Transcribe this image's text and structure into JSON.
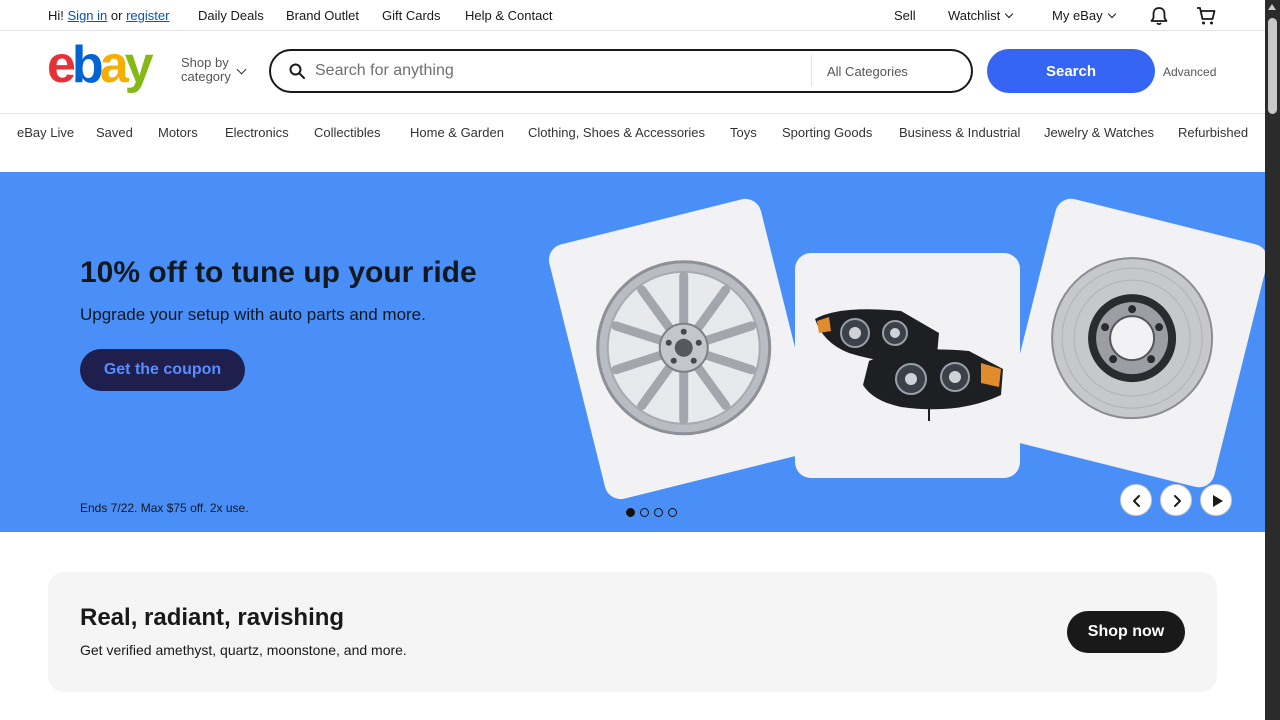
{
  "topbar": {
    "greeting": "Hi!",
    "sign_in": "Sign in",
    "or": "or",
    "register": "register",
    "links": [
      "Daily Deals",
      "Brand Outlet",
      "Gift Cards",
      "Help & Contact"
    ],
    "sell": "Sell",
    "watchlist": "Watchlist",
    "my_ebay": "My eBay",
    "icons": [
      "bell-icon",
      "cart-icon"
    ]
  },
  "header": {
    "logo_text": "ebay",
    "shop_by_line1": "Shop by",
    "shop_by_line2": "category",
    "search_placeholder": "Search for anything",
    "category_value": "All Categories",
    "search_button": "Search",
    "advanced": "Advanced"
  },
  "nav": {
    "items": [
      "eBay Live",
      "Saved",
      "Motors",
      "Electronics",
      "Collectibles",
      "Home & Garden",
      "Clothing, Shoes & Accessories",
      "Toys",
      "Sporting Goods",
      "Business & Industrial",
      "Jewelry & Watches",
      "Refurbished"
    ]
  },
  "hero": {
    "title": "10% off to tune up your ride",
    "subtitle": "Upgrade your setup with auto parts and more.",
    "cta": "Get the coupon",
    "terms": "Ends 7/22. Max $75 off. 2x use.",
    "slides_total": 4,
    "active_slide": 1,
    "images": [
      "wheel-rim-image",
      "headlights-image",
      "brake-rotor-image"
    ],
    "bg_color": "#4a8ff7"
  },
  "promo": {
    "title": "Real, radiant, ravishing",
    "text": "Get verified amethyst, quartz, moonstone, and more.",
    "cta": "Shop now"
  },
  "colors": {
    "accent": "#3665f3",
    "link": "#0654ba",
    "logo_e": "#e53238",
    "logo_b": "#0064d2",
    "logo_a": "#f5af02",
    "logo_y": "#86b817"
  }
}
